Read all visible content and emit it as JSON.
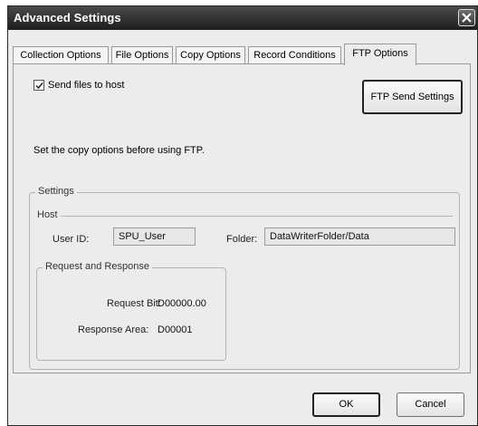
{
  "window": {
    "title": "Advanced Settings"
  },
  "tabs": [
    {
      "label": "Collection Options",
      "active": false
    },
    {
      "label": "File Options",
      "active": false
    },
    {
      "label": "Copy Options",
      "active": false
    },
    {
      "label": "Record Conditions",
      "active": false
    },
    {
      "label": "FTP Options",
      "active": true
    }
  ],
  "ftp": {
    "send_files_label": "Send files to host",
    "send_files_checked": true,
    "send_settings_button": "FTP Send Settings",
    "info_text": "Set the copy options before using FTP."
  },
  "settings": {
    "group_label": "Settings",
    "host": {
      "group_label": "Host",
      "user_id_label": "User ID:",
      "user_id_value": "SPU_User",
      "folder_label": "Folder:",
      "folder_value": "DataWriterFolder/Data"
    },
    "request_response": {
      "group_label": "Request and Response",
      "request_bit_label": "Request Bit:",
      "request_bit_value": "D00000.00",
      "response_area_label": "Response Area:",
      "response_area_value": "D00001"
    }
  },
  "footer": {
    "ok_label": "OK",
    "cancel_label": "Cancel"
  }
}
